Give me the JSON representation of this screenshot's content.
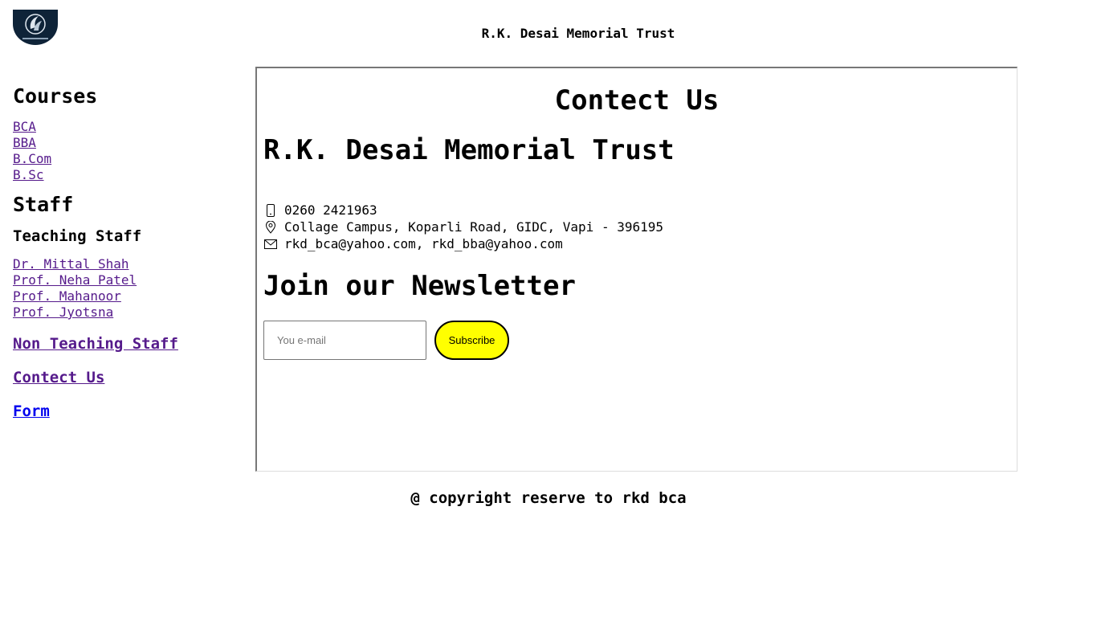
{
  "header": {
    "site_title": "R.K. Desai Memorial Trust"
  },
  "sidebar": {
    "courses_heading": "Courses",
    "courses": [
      "BCA",
      "BBA",
      "B.Com",
      "B.Sc"
    ],
    "staff_heading": "Staff",
    "teaching_heading": "Teaching Staff",
    "teaching_staff": [
      "Dr. Mittal Shah",
      "Prof. Neha Patel",
      "Prof. Mahanoor",
      "Prof. Jyotsna"
    ],
    "non_teaching_link": "Non Teaching Staff",
    "contact_link": "Contect Us",
    "form_link": "Form"
  },
  "main": {
    "title": "Contect Us",
    "trust_name": "R.K. Desai Memorial Trust",
    "phone": "0260 2421963",
    "address": "Collage Campus, Koparli Road, GIDC, Vapi - 396195",
    "emails": "rkd_bca@yahoo.com, rkd_bba@yahoo.com",
    "newsletter_heading": "Join our Newsletter",
    "email_placeholder": "You e-mail",
    "subscribe_label": "Subscribe"
  },
  "footer": {
    "copyright": "@ copyright reserve to rkd bca"
  },
  "icons": {
    "logo": "college-logo-icon",
    "phone": "phone-icon",
    "location": "location-pin-icon",
    "mail": "mail-icon"
  },
  "colors": {
    "link_visited": "#551a8b",
    "link_unvisited": "#0000ee",
    "subscribe_bg": "#ffff00",
    "logo_bg": "#0e2338"
  }
}
